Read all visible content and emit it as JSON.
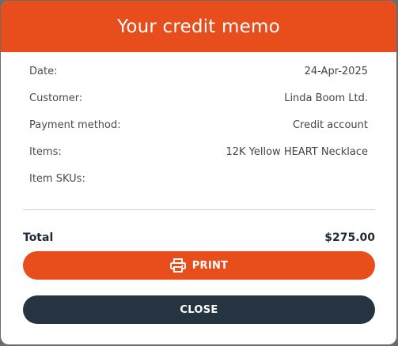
{
  "header": {
    "title": "Your credit memo"
  },
  "details": [
    {
      "label": "Date:",
      "value": "24-Apr-2025"
    },
    {
      "label": "Customer:",
      "value": "Linda Boom Ltd."
    },
    {
      "label": "Payment method:",
      "value": "Credit account"
    },
    {
      "label": "Items:",
      "value": "12K Yellow HEART Necklace"
    },
    {
      "label": "Item SKUs:",
      "value": ""
    }
  ],
  "total": {
    "label": "Total",
    "value": "$275.00"
  },
  "actions": {
    "print_label": "PRINT",
    "print_icon": "printer-icon",
    "close_label": "CLOSE"
  },
  "colors": {
    "accent": "#e84d1c",
    "dark": "#263340"
  }
}
